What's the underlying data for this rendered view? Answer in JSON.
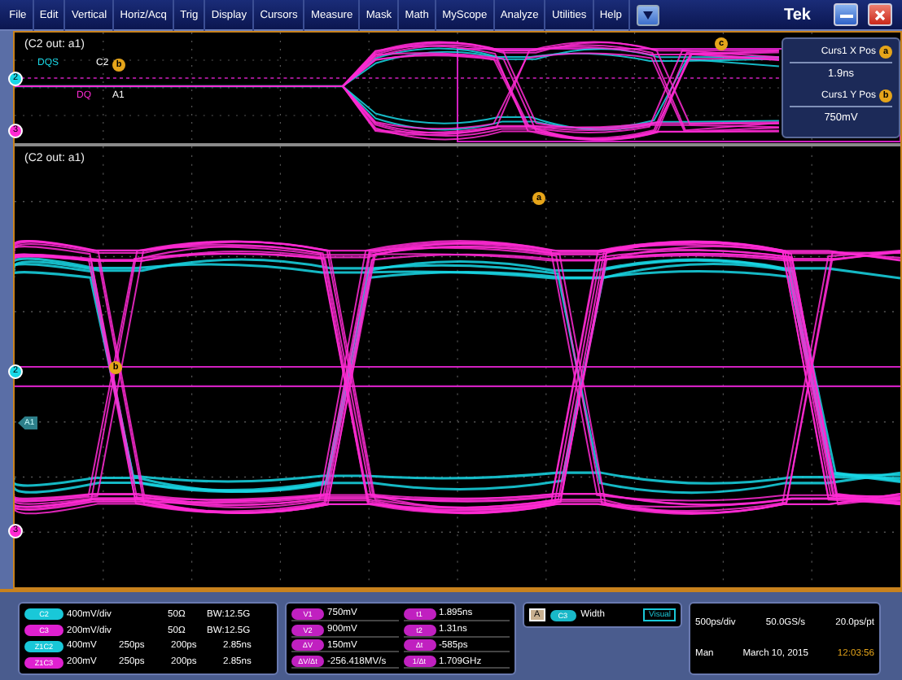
{
  "menu": [
    {
      "label": "File"
    },
    {
      "label": "Edit"
    },
    {
      "label": "Vertical"
    },
    {
      "label": "Horiz/Acq"
    },
    {
      "label": "Trig"
    },
    {
      "label": "Display"
    },
    {
      "label": "Cursors"
    },
    {
      "label": "Measure"
    },
    {
      "label": "Mask"
    },
    {
      "label": "Math"
    },
    {
      "label": "MyScope"
    },
    {
      "label": "Analyze"
    },
    {
      "label": "Utilities"
    },
    {
      "label": "Help"
    }
  ],
  "brand": "Tek",
  "upper_plot": {
    "title": "(C2 out: a1)",
    "channel_markers": [
      {
        "text": "2",
        "color": "#19d8e6"
      },
      {
        "text": "3",
        "color": "#ff2ad4"
      }
    ],
    "trace_labels": [
      {
        "text": "DQS",
        "color": "#19d8e6"
      },
      {
        "text": "C2",
        "color": "#ffffff"
      },
      {
        "text": "DQ",
        "color": "#ff2ad4"
      },
      {
        "text": "A1",
        "color": "#ffffff"
      }
    ],
    "cursor_badges": [
      "b",
      "c"
    ]
  },
  "lower_plot": {
    "title": "(C2 out: a1)",
    "channel_markers": [
      {
        "text": "2",
        "color": "#19d8e6"
      },
      {
        "text": "3",
        "color": "#ff2ad4"
      }
    ],
    "reference_marker": "A1",
    "cursor_badges": [
      "a",
      "b"
    ]
  },
  "cursor_readout": [
    {
      "label": "Curs1 X Pos",
      "badge": "a",
      "value": "1.9ns"
    },
    {
      "label": "Curs1 Y Pos",
      "badge": "b",
      "value": "750mV"
    }
  ],
  "channels": [
    {
      "kind": "channel",
      "badge": "C2",
      "color": "#19c8d8",
      "cells": [
        "400mV/div",
        "50Ω",
        "BW:12.5G"
      ]
    },
    {
      "kind": "channel",
      "badge": "C3",
      "color": "#e020d0",
      "cells": [
        "200mV/div",
        "50Ω",
        "BW:12.5G"
      ]
    },
    {
      "kind": "zoom",
      "badge": "Z1C2",
      "color": "#19c8d8",
      "cells": [
        "400mV",
        "250ps",
        "200ps",
        "2.85ns"
      ]
    },
    {
      "kind": "zoom",
      "badge": "Z1C3",
      "color": "#e020d0",
      "cells": [
        "200mV",
        "250ps",
        "200ps",
        "2.85ns"
      ]
    }
  ],
  "cursor_values": [
    [
      {
        "badge": "V1",
        "value": "750mV"
      },
      {
        "badge": "V2",
        "value": "900mV"
      },
      {
        "badge": "ΔV",
        "value": "150mV"
      },
      {
        "badge": "ΔV/Δt",
        "value": "-256.418MV/s"
      }
    ],
    [
      {
        "badge": "t1",
        "value": "1.895ns"
      },
      {
        "badge": "t2",
        "value": "1.31ns"
      },
      {
        "badge": "Δt",
        "value": "-585ps"
      },
      {
        "badge": "1/Δt",
        "value": "1.709GHz"
      }
    ]
  ],
  "measurement": {
    "slot": "A",
    "source": "C3",
    "name": "Width",
    "mode": "Visual"
  },
  "acquisition": {
    "timebase": "500ps/div",
    "sample_rate": "50.0GS/s",
    "resolution": "20.0ps/pt",
    "day": "Man",
    "date": "March 10, 2015",
    "time": "12:03:56"
  }
}
